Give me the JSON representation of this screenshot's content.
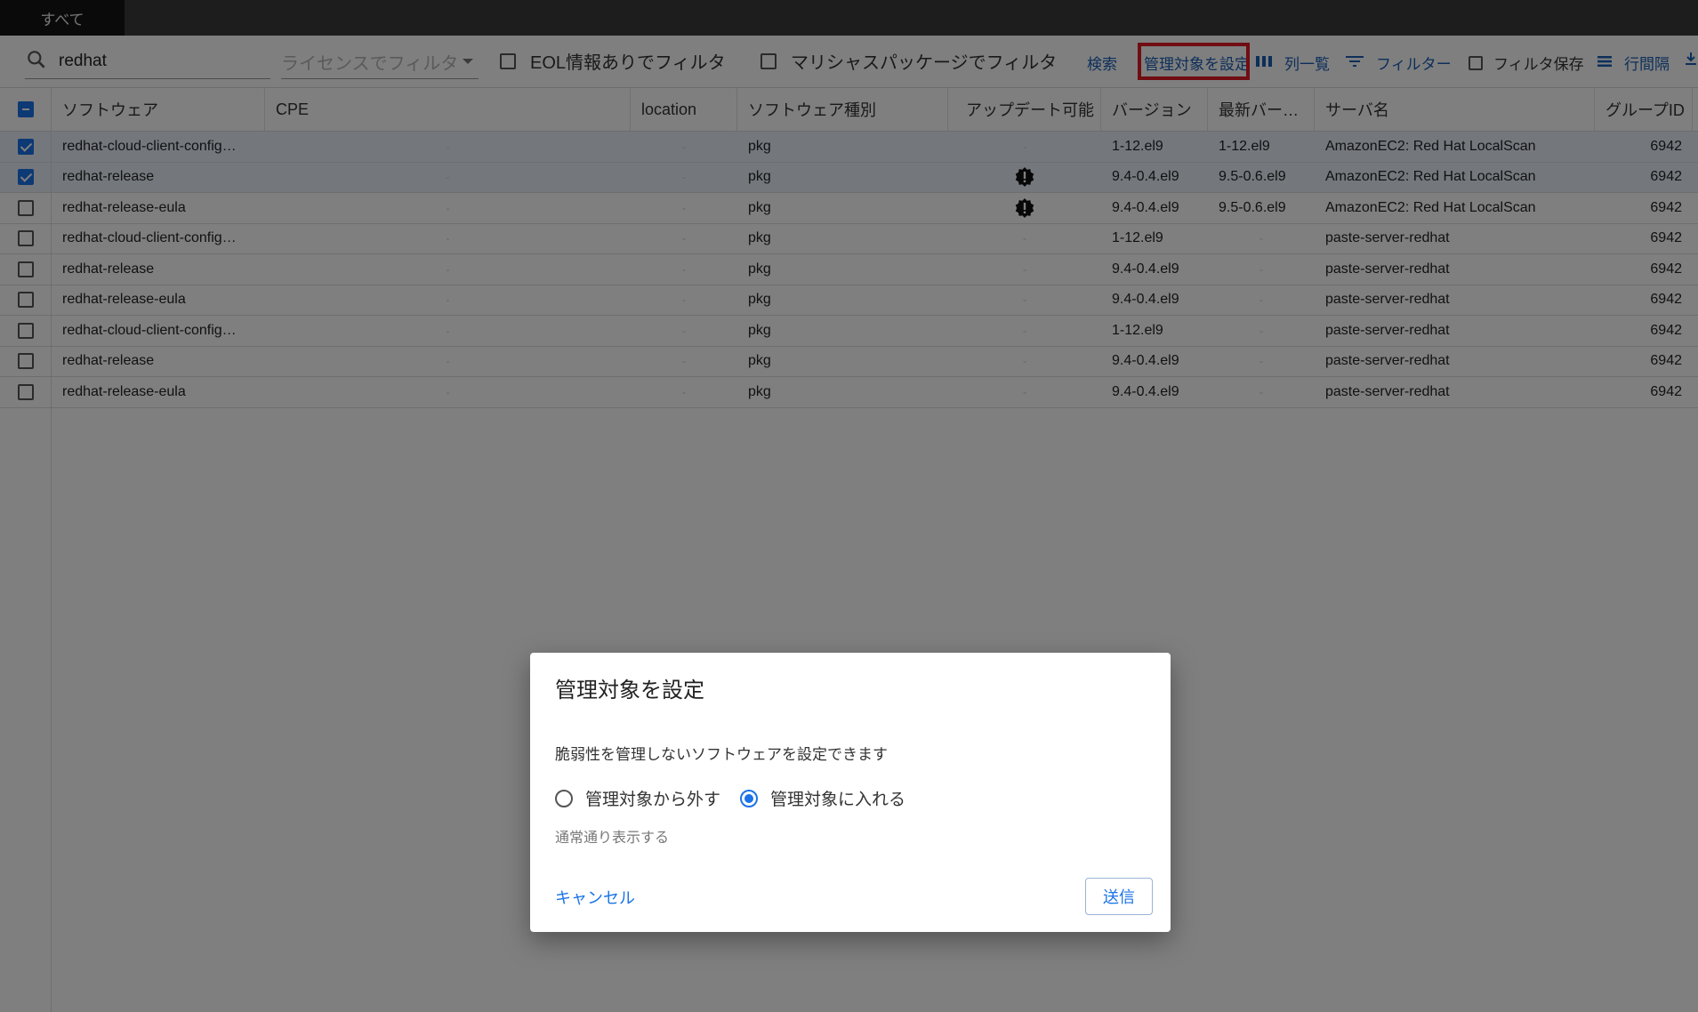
{
  "tabs": {
    "all": "すべて"
  },
  "toolbar": {
    "search_value": "redhat",
    "license_filter_placeholder": "ライセンスでフィルタ",
    "eol_filter_label": "EOL情報ありでフィルタ",
    "malicious_filter_label": "マリシャスパッケージでフィルタ",
    "search_label": "検索",
    "set_managed_label": "管理対象を設定",
    "columns_label": "列一覧",
    "filter_label": "フィルター",
    "save_filter_label": "フィルタ保存",
    "density_label": "行間隔"
  },
  "table": {
    "headers": {
      "software": "ソフトウェア",
      "cpe": "CPE",
      "location": "location",
      "type": "ソフトウェア種別",
      "updatable": "アップデート可能",
      "version": "バージョン",
      "latest": "最新バー…",
      "server": "サーバ名",
      "group_id": "グループID"
    },
    "dash": "-",
    "rows": [
      {
        "software": "redhat-cloud-client-config…",
        "type": "pkg",
        "version": "1-12.el9",
        "latest": "1-12.el9",
        "server": "AmazonEC2: Red Hat LocalScan",
        "group_id": "6942"
      },
      {
        "software": "redhat-release",
        "type": "pkg",
        "version": "9.4-0.4.el9",
        "latest": "9.5-0.6.el9",
        "server": "AmazonEC2: Red Hat LocalScan",
        "group_id": "6942"
      },
      {
        "software": "redhat-release-eula",
        "type": "pkg",
        "version": "9.4-0.4.el9",
        "latest": "9.5-0.6.el9",
        "server": "AmazonEC2: Red Hat LocalScan",
        "group_id": "6942"
      },
      {
        "software": "redhat-cloud-client-config…",
        "type": "pkg",
        "version": "1-12.el9",
        "latest": "-",
        "server": "paste-server-redhat",
        "group_id": "6942"
      },
      {
        "software": "redhat-release",
        "type": "pkg",
        "version": "9.4-0.4.el9",
        "latest": "-",
        "server": "paste-server-redhat",
        "group_id": "6942"
      },
      {
        "software": "redhat-release-eula",
        "type": "pkg",
        "version": "9.4-0.4.el9",
        "latest": "-",
        "server": "paste-server-redhat",
        "group_id": "6942"
      },
      {
        "software": "redhat-cloud-client-config…",
        "type": "pkg",
        "version": "1-12.el9",
        "latest": "-",
        "server": "paste-server-redhat",
        "group_id": "6942"
      },
      {
        "software": "redhat-release",
        "type": "pkg",
        "version": "9.4-0.4.el9",
        "latest": "-",
        "server": "paste-server-redhat",
        "group_id": "6942"
      },
      {
        "software": "redhat-release-eula",
        "type": "pkg",
        "version": "9.4-0.4.el9",
        "latest": "-",
        "server": "paste-server-redhat",
        "group_id": "6942"
      }
    ]
  },
  "dialog": {
    "title": "管理対象を設定",
    "description": "脆弱性を管理しないソフトウェアを設定できます",
    "option_exclude": "管理対象から外す",
    "option_include": "管理対象に入れる",
    "helper": "通常通り表示する",
    "cancel": "キャンセル",
    "submit": "送信"
  },
  "colors": {
    "accent": "#1a73e8",
    "highlight": "#e01b24"
  }
}
